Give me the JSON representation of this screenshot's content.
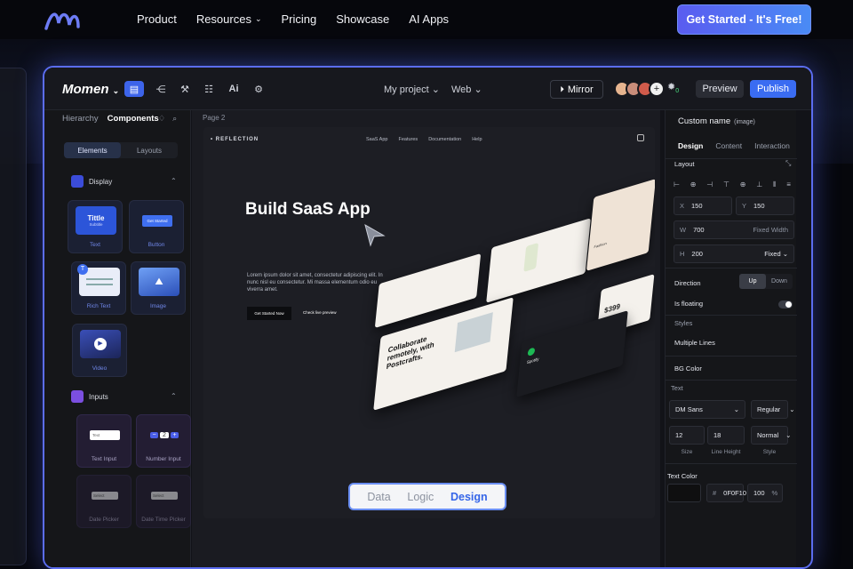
{
  "site": {
    "nav": [
      "Product",
      "Resources",
      "Pricing",
      "Showcase",
      "AI Apps"
    ],
    "cta_label": "Get Started - It's Free!"
  },
  "app": {
    "logo": "Momen",
    "project": "My project",
    "platform": "Web",
    "mirror_label": "Mirror",
    "badge_count": "0",
    "preview_label": "Preview",
    "publish_label": "Publish"
  },
  "left_panel": {
    "tabs": [
      "Hierarchy",
      "Components"
    ],
    "segments": [
      "Elements",
      "Layouts"
    ],
    "display_group": "Display",
    "inputs_group": "Inputs",
    "tiles": {
      "text": {
        "label": "Text",
        "title": "Tittle",
        "subtitle": "Subtitle"
      },
      "button": {
        "label": "Button",
        "inner": "Get Started"
      },
      "rich_text": {
        "label": "Rich Text"
      },
      "image": {
        "label": "Image"
      },
      "video": {
        "label": "Video"
      },
      "text_input": {
        "label": "Text Input",
        "inner": "Text"
      },
      "number_input": {
        "label": "Number Input",
        "value": "2"
      },
      "date_picker": {
        "label": "Date Picker",
        "inner": "Select"
      },
      "date_time_picker": {
        "label": "Date Time Picker",
        "inner": "Select"
      }
    }
  },
  "canvas": {
    "page_label": "Page 2",
    "preview": {
      "brand": "REFLECTION",
      "nav": [
        "SaaS App",
        "Features",
        "Documentation",
        "Help"
      ],
      "hero": "Build SaaS App",
      "desc": "Lorem ipsum dolor sit amet, consectetur adipiscing elit. In nunc nisl eu consectetur. Mi massa elementum odio eu viverra amet.",
      "btn_primary": "Get Started Now",
      "btn_secondary": "Check live preview",
      "collage_headline": "Collaborate remotely, with Postcrafts.",
      "price": "$399",
      "fashion": "Fashion",
      "app_card": "Spotify"
    }
  },
  "bottom_tabs": [
    "Data",
    "Logic",
    "Design"
  ],
  "right_panel": {
    "title": "Custom name",
    "title_hint": "(image)",
    "tabs": [
      "Design",
      "Content",
      "Interaction"
    ],
    "layout_label": "Layout",
    "x": "150",
    "y": "150",
    "w": "700",
    "w_mode": "Fixed Width",
    "h": "200",
    "h_mode": "Fixed",
    "direction_label": "Direction",
    "direction_options": [
      "Up",
      "Down"
    ],
    "floating_label": "Is floating",
    "styles_label": "Styles",
    "multiple_lines": "Multiple Lines",
    "bg_color": "BG Color",
    "text_label": "Text",
    "font": "DM Sans",
    "weight": "Regular",
    "size": "12",
    "line_height": "18",
    "style": "Normal",
    "size_caption": "Size",
    "line_height_caption": "Line Height",
    "style_caption": "Style",
    "text_color_label": "Text Color",
    "color_hex": "0F0F10",
    "opacity": "100",
    "percent": "%"
  },
  "colors": {
    "accent": "#3a6cf2",
    "frame_glow": "#5b6df0",
    "bg": "#06070c"
  }
}
